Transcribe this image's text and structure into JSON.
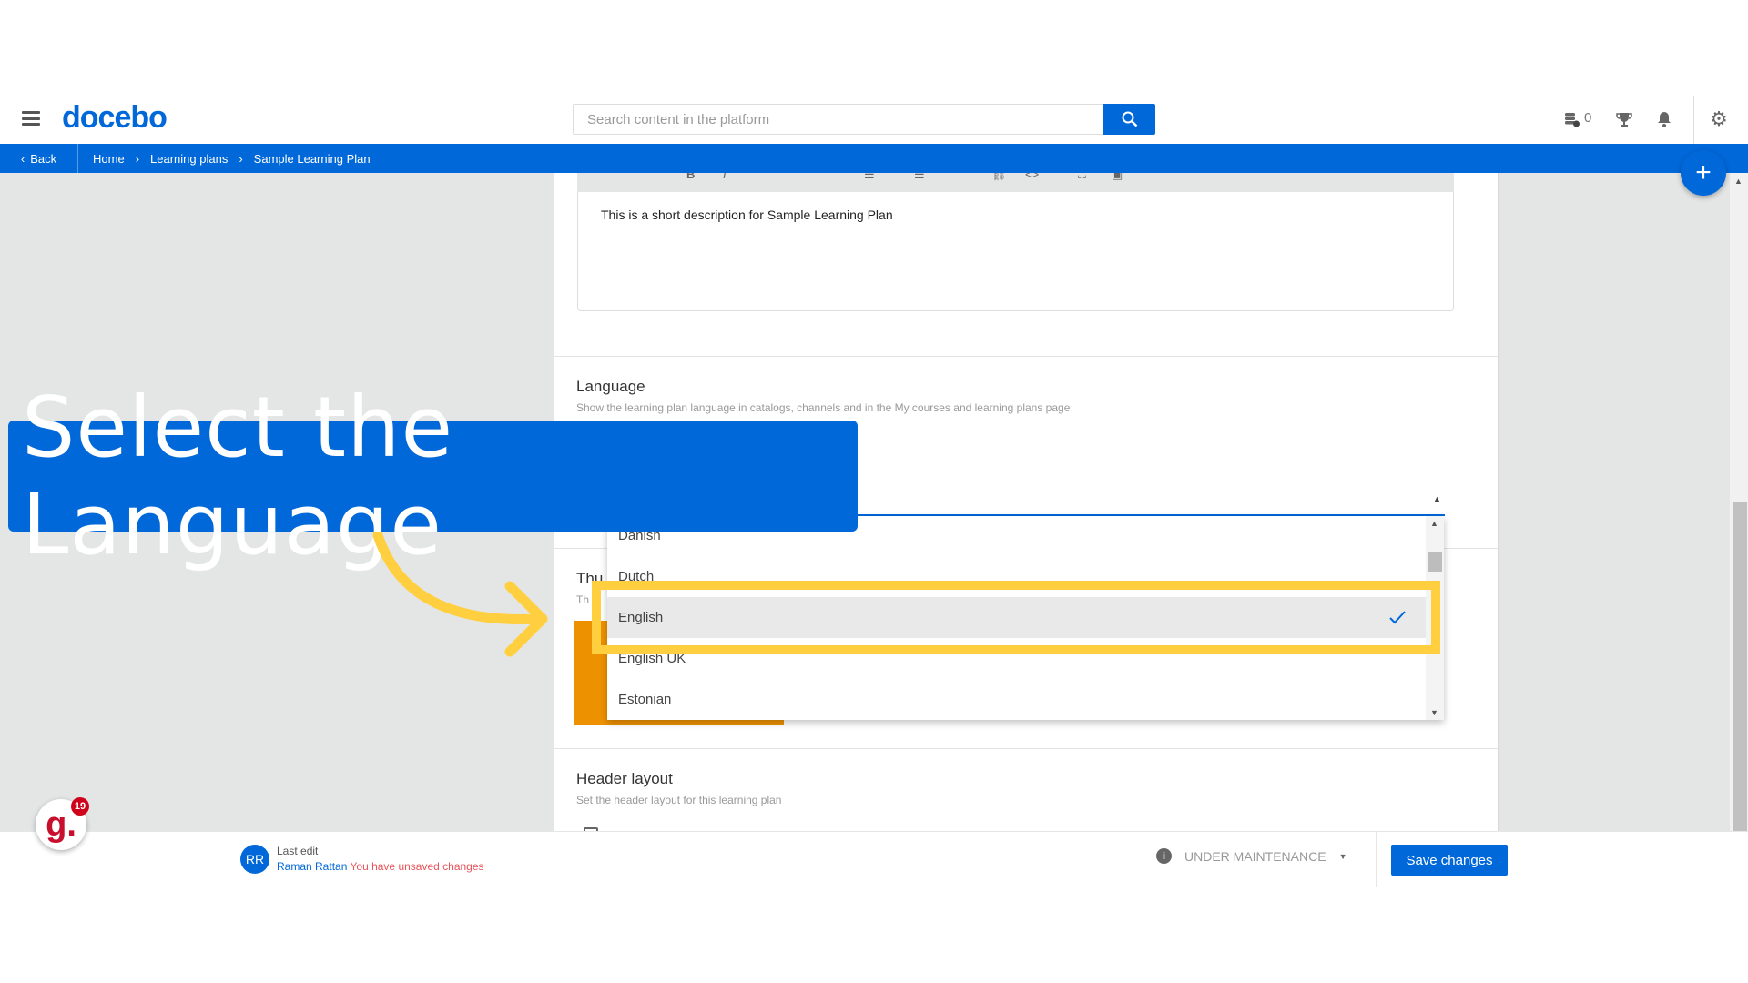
{
  "header": {
    "logo": "docebo",
    "search_placeholder": "Search content in the platform",
    "coins_count": "0"
  },
  "breadcrumb": {
    "back": "Back",
    "items": [
      "Home",
      "Learning plans",
      "Sample Learning Plan"
    ]
  },
  "editor": {
    "text": "This is a short description for Sample Learning Plan"
  },
  "language": {
    "title": "Language",
    "description": "Show the learning plan language in catalogs, channels and in the My courses and learning plans page",
    "options": [
      "Danish",
      "Dutch",
      "English",
      "English UK",
      "Estonian"
    ],
    "selected": "English"
  },
  "thumbnail": {
    "title_partial": "Thu",
    "desc_partial": "Th"
  },
  "header_layout": {
    "title": "Header layout",
    "description": "Set the header layout for this learning plan"
  },
  "footer": {
    "avatar_initials": "RR",
    "last_edit_label": "Last edit",
    "editor_name": "Raman Rattan",
    "unsaved": "You have unsaved changes",
    "status": "UNDER MAINTENANCE",
    "save": "Save changes"
  },
  "callout": {
    "text": "Select the Language"
  },
  "widget": {
    "badge": "19",
    "logo": "g."
  },
  "colors": {
    "brand": "#0068d9",
    "highlight": "#ffcf3f",
    "thumbnail": "#ee9100",
    "warning_text": "#e8545a"
  }
}
